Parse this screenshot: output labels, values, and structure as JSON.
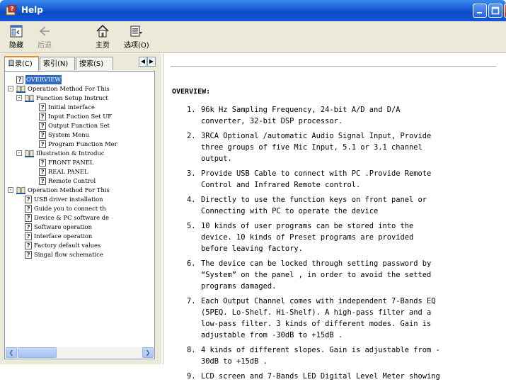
{
  "window": {
    "title": "Help"
  },
  "toolbar": {
    "hide": "隐藏",
    "back": "后退",
    "home": "主页",
    "options": "选项(O)"
  },
  "tabs": [
    "目录(C)",
    "索引(N)",
    "搜索(S)"
  ],
  "tree": [
    {
      "type": "page",
      "label": "OVERVIEW",
      "selected": true
    },
    {
      "type": "book",
      "label": "Operation Method For This"
    },
    {
      "type": "book",
      "label": "Function Setup Instruct"
    },
    {
      "type": "page",
      "label": "Initial interface"
    },
    {
      "type": "page",
      "label": "Input Fuction Set UF"
    },
    {
      "type": "page",
      "label": "Output Function Set"
    },
    {
      "type": "page",
      "label": "System Menu"
    },
    {
      "type": "page",
      "label": "Program Function Mer"
    },
    {
      "type": "book",
      "label": "Illustration & Introduc"
    },
    {
      "type": "page",
      "label": "FRONT PANEL"
    },
    {
      "type": "page",
      "label": "REAL PANEL"
    },
    {
      "type": "page",
      "label": "Remote Control"
    },
    {
      "type": "book",
      "label": "Operation Method For This"
    },
    {
      "type": "page",
      "label": "USB driver installation"
    },
    {
      "type": "page",
      "label": "Guide you to connect th"
    },
    {
      "type": "page",
      "label": "Device & PC software de"
    },
    {
      "type": "page",
      "label": "Software operation"
    },
    {
      "type": "page",
      "label": "Interface operation"
    },
    {
      "type": "page",
      "label": "Factory default values"
    },
    {
      "type": "page",
      "label": "Singal flow schematice"
    }
  ],
  "content": {
    "heading": "OVERVIEW:",
    "items": [
      {
        "num": "1.",
        "lines": [
          "96k Hz Sampling Frequency, 24-bit A/D and D/A",
          "converter, 32-bit DSP processor."
        ]
      },
      {
        "num": "2.",
        "lines": [
          "3RCA Optional /automatic Audio Signal Input, Provide",
          "three groups of five Mic Input, 5.1 or 3.1 channel",
          "output."
        ]
      },
      {
        "num": "3.",
        "lines": [
          "Provide USB Cable to connect with PC .Provide Remote",
          "Control and Infrared Remote control."
        ]
      },
      {
        "num": "4.",
        "lines": [
          "Directly to use the function keys on front panel or",
          "Connecting with PC to operate the device"
        ]
      },
      {
        "num": "5.",
        "lines": [
          "10 kinds of user programs can be stored into the",
          "device. 10 kinds of Preset programs are provided",
          "before leaving factory."
        ]
      },
      {
        "num": "6.",
        "lines": [
          "The device can be locked through setting password by",
          "“System” on the panel , in order to avoid the setted",
          "programs damaged."
        ]
      },
      {
        "num": "7.",
        "lines": [
          "Each Output Channel comes with independent 7-Bands EQ",
          "(5PEQ. Lo-Shelf. Hi-Shelf). A high-pass filter and a",
          "low-pass filter. 3 kinds of different modes. Gain is",
          "adjustable from -30dB to +15dB ."
        ]
      },
      {
        "num": "8.",
        "lines": [
          "4 kinds of different slopes. Gain is adjustable from -",
          "30dB to +15dB ."
        ]
      },
      {
        "num": "9.",
        "lines": [
          "LCD screen and 7-Bands LED Digital Level Meter showing"
        ]
      }
    ]
  }
}
